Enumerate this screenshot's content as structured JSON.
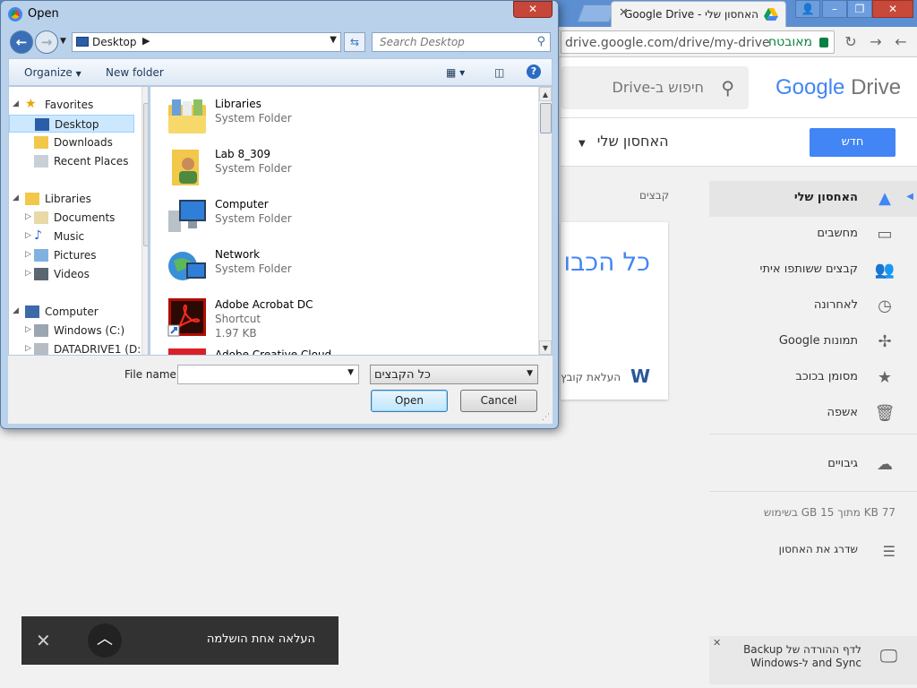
{
  "chrome": {
    "tab_title": "האחסון שלי - Google Drive",
    "url": "drive.google.com/drive/my-drive",
    "secure_label": "מאובטח"
  },
  "drive": {
    "logo_google": "Google",
    "logo_drive": "Drive",
    "search_placeholder": "חיפוש ב-Drive",
    "new_button": "חדש",
    "mydrive_title": "האחסון שלי",
    "files_label": "קבצים",
    "card_big_text": "כל הכבו",
    "card_upload_text": "העלאת קובץ",
    "sidebar": [
      {
        "label": "האחסון שלי",
        "icon": "drive-icon",
        "active": true
      },
      {
        "label": "מחשבים",
        "icon": "computers-icon"
      },
      {
        "label": "קבצים ששותפו איתי",
        "icon": "shared-icon"
      },
      {
        "label": "לאחרונה",
        "icon": "clock-icon"
      },
      {
        "label": "תמונות Google",
        "icon": "photos-icon"
      },
      {
        "label": "מסומן בכוכב",
        "icon": "star-icon"
      },
      {
        "label": "אשפה",
        "icon": "trash-icon"
      }
    ],
    "backups_label": "גיבויים",
    "quota_text": "77 KB מתוך 15 GB בשימוש",
    "upgrade_label": "שדרג את האחסון",
    "backup_promo": "לדף ההורדה של Backup and Sync ל-Windows",
    "toast_message": "העלאה אחת הושלמה"
  },
  "dialog": {
    "title": "Open",
    "address": "Desktop",
    "search_placeholder": "Search Desktop",
    "organize": "Organize",
    "new_folder": "New folder",
    "nav": {
      "favorites": "Favorites",
      "desktop": "Desktop",
      "downloads": "Downloads",
      "recent_places": "Recent Places",
      "libraries": "Libraries",
      "documents": "Documents",
      "music": "Music",
      "pictures": "Pictures",
      "videos": "Videos",
      "computer": "Computer",
      "windows_c": "Windows (C:)",
      "datadrive": "DATADRIVE1 (D:)"
    },
    "files": [
      {
        "name": "Libraries",
        "type": "System Folder",
        "icon": "libraries-folder-icon"
      },
      {
        "name": "Lab 8_309",
        "type": "System Folder",
        "icon": "user-folder-icon"
      },
      {
        "name": "Computer",
        "type": "System Folder",
        "icon": "computer-icon"
      },
      {
        "name": "Network",
        "type": "System Folder",
        "icon": "network-icon"
      },
      {
        "name": "Adobe Acrobat DC",
        "type": "Shortcut",
        "size": "1.97 KB",
        "icon": "acrobat-icon"
      },
      {
        "name": "Adobe Creative Cloud",
        "type": "",
        "icon": "creative-cloud-icon"
      }
    ],
    "file_name_label": "File name:",
    "file_name_value": "",
    "file_type": "כל הקבצים",
    "open_button": "Open",
    "cancel_button": "Cancel"
  },
  "colors": {
    "accent_blue": "#4285f4",
    "secure_green": "#0b8043",
    "toast_bg": "#323232"
  }
}
